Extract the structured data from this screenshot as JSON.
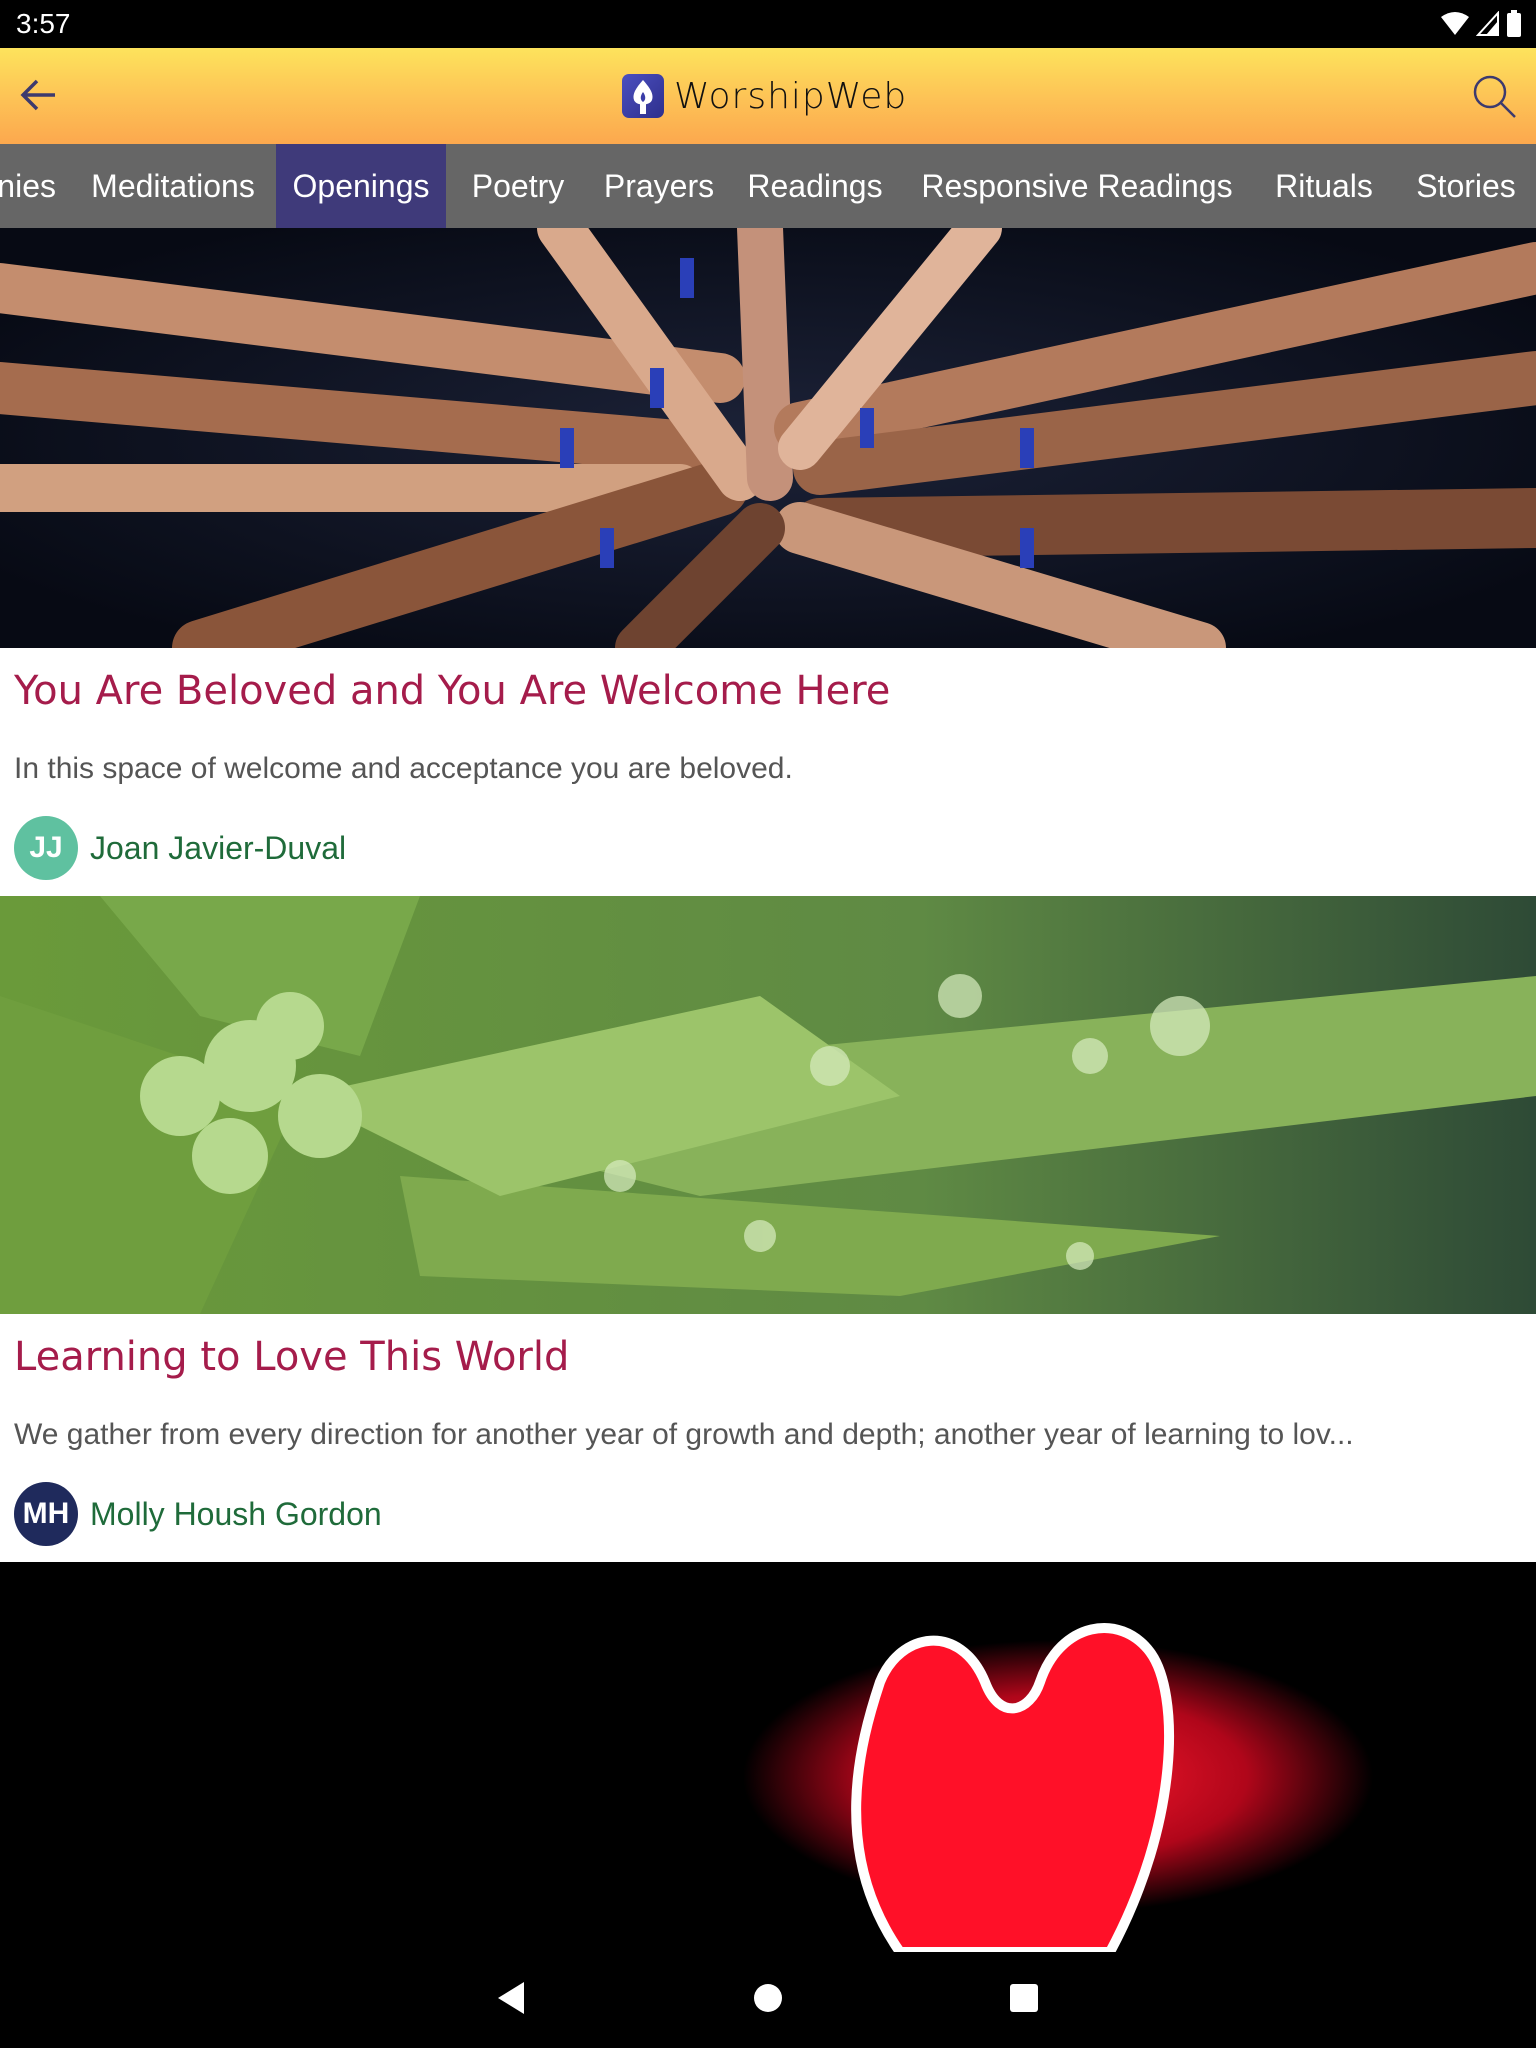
{
  "status_bar": {
    "time": "3:57",
    "icons": [
      "wifi-icon",
      "signal-icon",
      "battery-icon"
    ]
  },
  "app_bar": {
    "back_icon": "arrow-left-icon",
    "title": "WorshipWeb",
    "logo_icon": "flame-chalice-icon",
    "search_icon": "search-icon"
  },
  "tabs": {
    "items": [
      {
        "label": "nies"
      },
      {
        "label": "Meditations"
      },
      {
        "label": "Openings",
        "active": true
      },
      {
        "label": "Poetry"
      },
      {
        "label": "Prayers"
      },
      {
        "label": "Readings"
      },
      {
        "label": "Responsive Readings"
      },
      {
        "label": "Rituals"
      },
      {
        "label": "Stories"
      }
    ],
    "active_color": "#3f3a7a",
    "bar_color": "#666666"
  },
  "cards": [
    {
      "image": "hands-stacked-together-photo",
      "title": "You Are Beloved and You Are Welcome Here",
      "description": "In this space of welcome and acceptance you are beloved.",
      "author": {
        "initials": "JJ",
        "name": "Joan Javier-Duval",
        "avatar_color": "#5fc1a0"
      }
    },
    {
      "image": "green-lily-with-water-drops-photo",
      "title": "Learning to Love This World",
      "description": "We gather from every direction for another year of growth and depth; another year of learning to lov...",
      "author": {
        "initials": "MH",
        "name": "Molly Housh Gordon",
        "avatar_color": "#1f2a5c"
      }
    },
    {
      "image": "red-neon-heart-photo"
    }
  ],
  "colors": {
    "title": "#a51c4b",
    "author": "#1f6b3a",
    "description": "#555555"
  },
  "nav_bar": {
    "back": "nav-back-icon",
    "home": "nav-home-icon",
    "recents": "nav-recents-icon"
  }
}
